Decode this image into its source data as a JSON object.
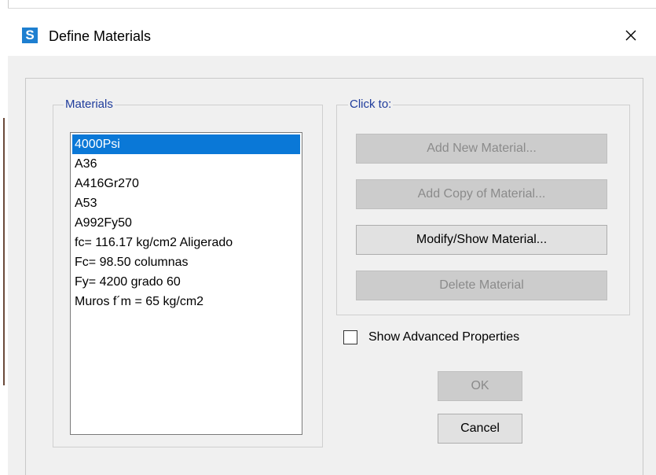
{
  "window": {
    "app_icon_letter": "S",
    "title": "Define Materials"
  },
  "materials": {
    "label": "Materials",
    "items": [
      "4000Psi",
      "A36",
      "A416Gr270",
      "A53",
      "A992Fy50",
      "fc= 116.17 kg/cm2 Aligerado",
      "Fc= 98.50 columnas",
      "Fy= 4200 grado 60",
      "Muros f´m = 65 kg/cm2"
    ],
    "selected_index": 0
  },
  "click_to": {
    "label": "Click to:",
    "add_new": "Add New Material...",
    "add_copy": "Add Copy of Material...",
    "modify_show": "Modify/Show Material...",
    "delete": "Delete Material"
  },
  "advanced": {
    "label": "Show Advanced Properties",
    "checked": false
  },
  "buttons": {
    "ok": "OK",
    "cancel": "Cancel"
  },
  "colors": {
    "accent": "#0a78d7",
    "app_icon": "#1e7fd0",
    "group_label": "#1f3c9c"
  }
}
